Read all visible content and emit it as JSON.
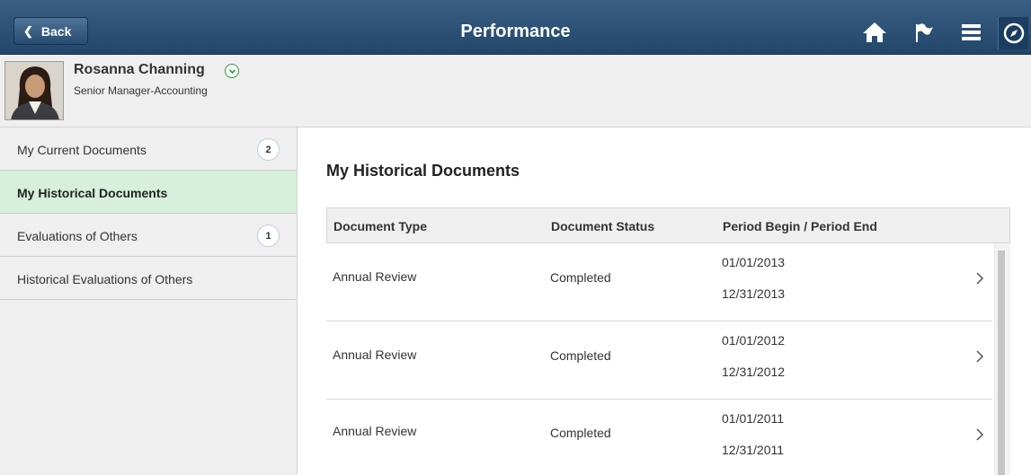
{
  "header": {
    "back_label": "Back",
    "title": "Performance",
    "icons": [
      "home-icon",
      "flag-icon",
      "menu-icon",
      "navbar-compass-icon"
    ]
  },
  "profile": {
    "name": "Rosanna Channing",
    "title": "Senior Manager-Accounting"
  },
  "sidebar": {
    "items": [
      {
        "label": "My Current Documents",
        "count": "2"
      },
      {
        "label": "My Historical Documents",
        "selected": true
      },
      {
        "label": "Evaluations of Others",
        "count": "1"
      },
      {
        "label": "Historical Evaluations of Others"
      }
    ]
  },
  "main": {
    "title": "My Historical Documents",
    "columns": [
      "Document Type",
      "Document Status",
      "Period Begin / Period End"
    ],
    "rows": [
      {
        "type": "Annual Review",
        "status": "Completed",
        "begin": "01/01/2013",
        "end": "12/31/2013"
      },
      {
        "type": "Annual Review",
        "status": "Completed",
        "begin": "01/01/2012",
        "end": "12/31/2012"
      },
      {
        "type": "Annual Review",
        "status": "Completed",
        "begin": "01/01/2011",
        "end": "12/31/2011"
      }
    ]
  },
  "colors": {
    "header_bg": "#2c5078",
    "selected_bg": "#d6f0db",
    "panel_bg": "#efefef",
    "status_green": "#2f9a3e"
  }
}
